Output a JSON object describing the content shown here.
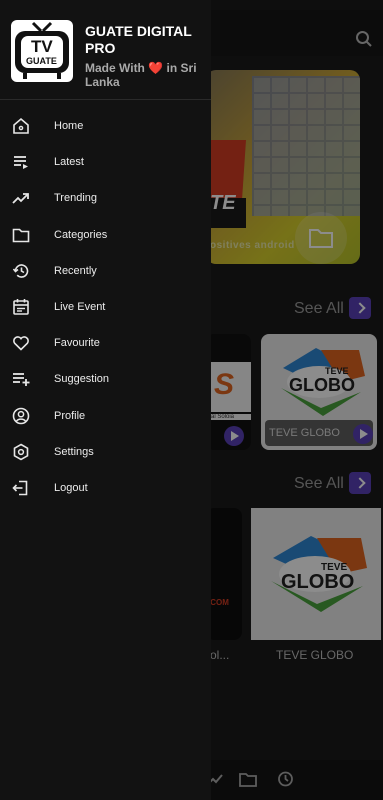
{
  "app": {
    "name": "GUATE DIGITAL PRO",
    "subtitle_prefix": "Made With",
    "subtitle_suffix": "in Sri Lanka",
    "logo_line1": "TV",
    "logo_line2": "GUATE"
  },
  "background": {
    "title_tail": "e",
    "banner_logo_text": "TE",
    "banner_caption": "ositives android",
    "sections": [
      {
        "see_all": "See All"
      },
      {
        "see_all": "See All"
      }
    ],
    "row1": [
      {
        "partial_text": "S",
        "partial_caption": "ntal Soloia"
      },
      {
        "logo_top": "TEVE",
        "logo_main": "GLOBO",
        "label": "TEVE GLOBO"
      }
    ],
    "row2": [
      {
        "partial_text": ".COM",
        "title": "ol..."
      },
      {
        "logo_top": "TEVE",
        "logo_main": "GLOBO",
        "title": "TEVE GLOBO"
      }
    ]
  },
  "menu": [
    {
      "label": "Home",
      "icon": "home-icon"
    },
    {
      "label": "Latest",
      "icon": "latest-icon"
    },
    {
      "label": "Trending",
      "icon": "trending-icon"
    },
    {
      "label": "Categories",
      "icon": "folder-icon"
    },
    {
      "label": "Recently",
      "icon": "history-icon"
    },
    {
      "label": "Live Event",
      "icon": "calendar-icon"
    },
    {
      "label": "Favourite",
      "icon": "heart-icon"
    },
    {
      "label": "Suggestion",
      "icon": "playlist-add-icon"
    },
    {
      "label": "Profile",
      "icon": "profile-icon"
    },
    {
      "label": "Settings",
      "icon": "settings-icon"
    },
    {
      "label": "Logout",
      "icon": "logout-icon"
    }
  ],
  "colors": {
    "accent": "#5a40b8",
    "drawer_bg": "#121212",
    "heart": "#e03a3a"
  }
}
